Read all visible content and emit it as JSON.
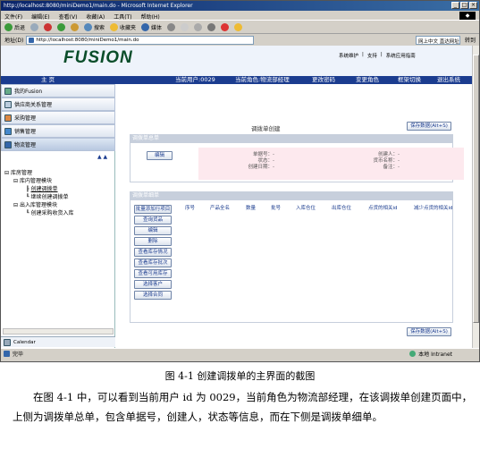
{
  "window": {
    "title": "http://localhost:8080/miniDemo1/main.do - Microsoft Internet Explorer",
    "min": "_",
    "max": "□",
    "close": "×"
  },
  "menubar": [
    "文件(F)",
    "编辑(E)",
    "查看(V)",
    "收藏(A)",
    "工具(T)",
    "帮助(H)"
  ],
  "toolbar": {
    "back": "后退",
    "search": "搜索",
    "favorites": "收藏夹",
    "media": "媒体"
  },
  "address": {
    "label": "地址(D)",
    "url": "http://localhost:8080/miniDemo1/main.do",
    "search_placeholder": "网上中文 直达网址",
    "go": "转到"
  },
  "header": {
    "logo": "FUSION",
    "links": [
      "系统维护",
      "|",
      "支持",
      "|",
      "系统应用指南"
    ]
  },
  "navbar": {
    "home": "主 页",
    "current_user": "当前用户:0029",
    "current_role": "当前角色:物流部经理",
    "change_password": "更改密码",
    "change_role": "变更角色",
    "frame_switch": "框架切换",
    "exit": "退出系统"
  },
  "sidebar": {
    "items": [
      {
        "label": "我的Fusion"
      },
      {
        "label": "供应商关系管理"
      },
      {
        "label": "采购管理"
      },
      {
        "label": "销售管理"
      },
      {
        "label": "物流管理"
      }
    ],
    "tree": [
      "库房管理",
      "库内管理模块",
      "创建调拨单",
      "继续创建调拨单",
      "出入库管理模块",
      "创建采购收货入库"
    ],
    "calendar": "Calendar"
  },
  "main": {
    "page_title": "调拨单创建",
    "save_label": "保存数据(Alt+S)",
    "master": {
      "header": "调拨单总单",
      "edit_button": "编辑",
      "fields_left": [
        "单据号：-",
        "状态：-",
        "创建日期：-"
      ],
      "fields_right": [
        "创建人：-",
        "货币名称：-",
        "备注：-"
      ]
    },
    "detail": {
      "header": "调拨单细单",
      "columns": [
        "序号",
        "产品全名",
        "数量",
        "批号",
        "入库仓位",
        "出库仓位",
        "点货的相关id",
        "减少点货的相关id"
      ],
      "buttons": [
        "批量添加行项目",
        "查询货品",
        "编辑",
        "删除",
        "查看库存情况",
        "查看库存批次",
        "查看可用库存",
        "选择客户",
        "选择合同"
      ]
    }
  },
  "statusbar": {
    "done": "完毕",
    "zone": "本地 Intranet"
  },
  "caption": "图 4-1  创建调拨单的主界面的截图",
  "paragraph": "在图 4-1 中，可以看到当前用户 id 为 0029，当前角色为物流部经理，在该调拨单创建页面中，上侧为调拨单总单，包含单据号，创建人，状态等信息，而在下侧是调拨单细单。"
}
